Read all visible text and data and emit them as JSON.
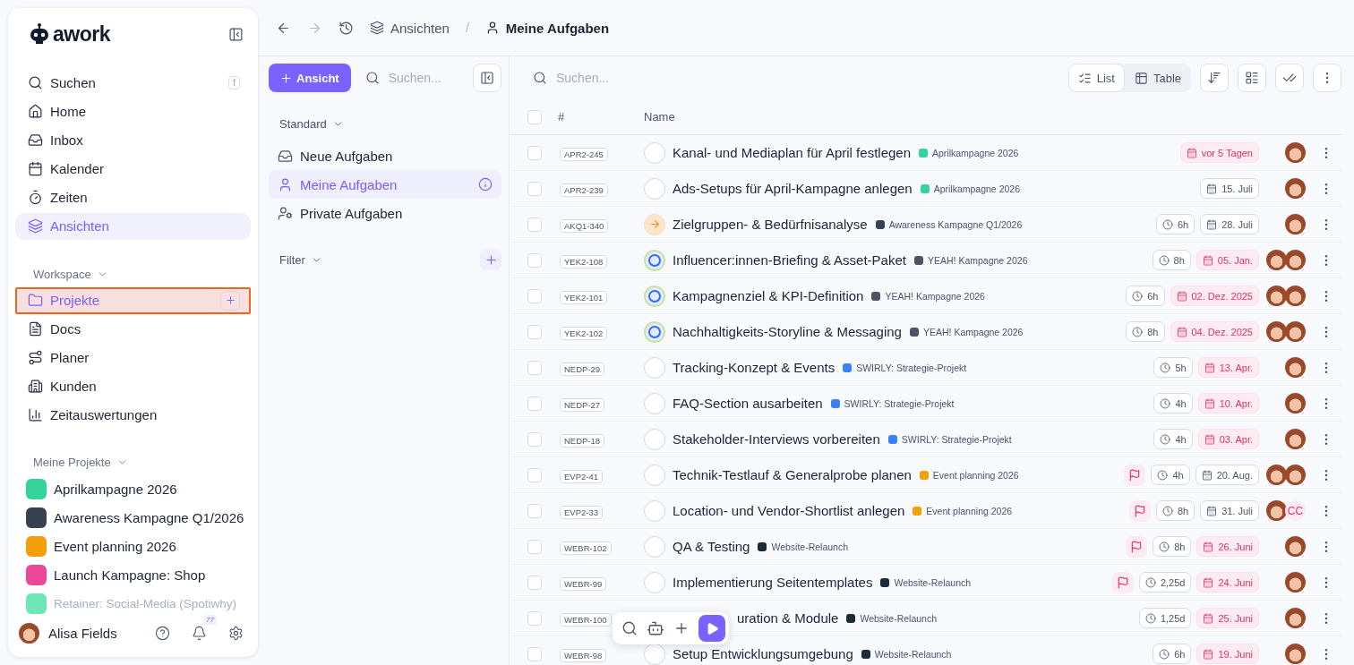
{
  "sidebar": {
    "logo": "awork",
    "search": {
      "label": "Suchen",
      "shortcut": "f"
    },
    "nav": [
      {
        "label": "Home",
        "selected": false
      },
      {
        "label": "Inbox",
        "selected": false
      },
      {
        "label": "Kalender",
        "selected": false
      },
      {
        "label": "Zeiten",
        "selected": false
      },
      {
        "label": "Ansichten",
        "selected": true
      }
    ],
    "workspace": {
      "title": "Workspace",
      "items": [
        {
          "label": "Projekte",
          "highlighted": true
        },
        {
          "label": "Docs",
          "highlighted": false
        },
        {
          "label": "Planer",
          "highlighted": false
        },
        {
          "label": "Kunden",
          "highlighted": false
        },
        {
          "label": "Zeitauswertungen",
          "highlighted": false
        }
      ]
    },
    "my_projects": {
      "title": "Meine Projekte",
      "items": [
        {
          "label": "Aprilkampagne 2026",
          "color": "#34d399",
          "faded": false
        },
        {
          "label": "Awareness Kampagne Q1/2026",
          "color": "#374151",
          "faded": false
        },
        {
          "label": "Event planning 2026",
          "color": "#f59e0b",
          "faded": false
        },
        {
          "label": "Launch Kampagne: Shop",
          "color": "#ec4899",
          "faded": false
        },
        {
          "label": "Retainer: Social-Media (Spotiwhy)",
          "color": "#6ee7b7",
          "faded": true
        }
      ]
    },
    "user": {
      "name": "Alisa Fields",
      "notifications": "77"
    }
  },
  "breadcrumb": {
    "separator": "/",
    "items": [
      "Ansichten",
      "Meine Aufgaben"
    ]
  },
  "views_panel": {
    "add_button": "Ansicht",
    "search_placeholder": "Suchen...",
    "group": "Standard",
    "views": [
      {
        "label": "Neue Aufgaben",
        "selected": false
      },
      {
        "label": "Meine Aufgaben",
        "selected": true
      },
      {
        "label": "Private Aufgaben",
        "selected": false
      }
    ],
    "filter": "Filter"
  },
  "tasks": {
    "search_placeholder": "Suchen...",
    "all_checked": false,
    "modes": [
      {
        "label": "List",
        "selected": true
      },
      {
        "label": "Table",
        "selected": false
      }
    ],
    "columns": [
      "#",
      "Name"
    ],
    "rows": [
      {
        "checked": false,
        "id": "APR2-245",
        "name": "Kanal- und Mediaplan für April festlegen",
        "kind": "open",
        "project": "Aprilkampagne 2026",
        "color": "#34d399",
        "flag": false,
        "due": {
          "text": "vor 5 Tagen",
          "overdue": true
        },
        "assignees": [
          {
            "kind": "avatar"
          }
        ]
      },
      {
        "checked": false,
        "id": "APR2-239",
        "name": "Ads-Setups für April-Kampagne anlegen",
        "kind": "open",
        "project": "Aprilkampagne 2026",
        "color": "#34d399",
        "flag": false,
        "due": {
          "text": "15. Juli",
          "overdue": false
        },
        "assignees": [
          {
            "kind": "avatar"
          }
        ]
      },
      {
        "checked": false,
        "id": "AKQ1-340",
        "name": "Zielgruppen- & Bedürfnisanalyse",
        "kind": "next",
        "project": "Awareness Kampagne Q1/2026",
        "color": "#374151",
        "flag": false,
        "effort": "6h",
        "due": {
          "text": "28. Juli",
          "overdue": false
        },
        "assignees": [
          {
            "kind": "avatar"
          }
        ]
      },
      {
        "checked": false,
        "id": "YEK2-108",
        "name": "Influencer:innen-Briefing & Asset-Paket",
        "kind": "progress",
        "project": "YEAH! Kampagne 2026",
        "color": "#4b5563",
        "flag": false,
        "effort": "8h",
        "due": {
          "text": "05. Jan.",
          "overdue": true
        },
        "assignees": [
          {
            "kind": "avatar"
          },
          {
            "kind": "avatar"
          }
        ]
      },
      {
        "checked": false,
        "id": "YEK2-101",
        "name": "Kampagnenziel & KPI-Definition",
        "kind": "progress",
        "project": "YEAH! Kampagne 2026",
        "color": "#4b5563",
        "flag": false,
        "effort": "6h",
        "due": {
          "text": "02. Dez. 2025",
          "overdue": true
        },
        "assignees": [
          {
            "kind": "avatar"
          },
          {
            "kind": "avatar"
          }
        ]
      },
      {
        "checked": false,
        "id": "YEK2-102",
        "name": "Nachhaltigkeits-Storyline & Messaging",
        "kind": "progress",
        "project": "YEAH! Kampagne 2026",
        "color": "#4b5563",
        "flag": false,
        "effort": "8h",
        "due": {
          "text": "04. Dez. 2025",
          "overdue": true
        },
        "assignees": [
          {
            "kind": "avatar"
          },
          {
            "kind": "avatar"
          }
        ]
      },
      {
        "checked": false,
        "id": "NEDP-29",
        "name": "Tracking-Konzept & Events",
        "kind": "open",
        "project": "SWIRLY: Strategie-Projekt",
        "color": "#3b82f6",
        "flag": false,
        "effort": "5h",
        "due": {
          "text": "13. Apr.",
          "overdue": true
        },
        "assignees": [
          {
            "kind": "avatar"
          }
        ]
      },
      {
        "checked": false,
        "id": "NEDP-27",
        "name": "FAQ-Section ausarbeiten",
        "kind": "open",
        "project": "SWIRLY: Strategie-Projekt",
        "color": "#3b82f6",
        "flag": false,
        "effort": "4h",
        "due": {
          "text": "10. Apr.",
          "overdue": true
        },
        "assignees": [
          {
            "kind": "avatar"
          }
        ]
      },
      {
        "checked": false,
        "id": "NEDP-18",
        "name": "Stakeholder-Interviews vorbereiten",
        "kind": "open",
        "project": "SWIRLY: Strategie-Projekt",
        "color": "#3b82f6",
        "flag": false,
        "effort": "4h",
        "due": {
          "text": "03. Apr.",
          "overdue": true
        },
        "assignees": [
          {
            "kind": "avatar"
          }
        ]
      },
      {
        "checked": false,
        "id": "EVP2-41",
        "name": "Technik-Testlauf & Generalprobe planen",
        "kind": "open",
        "project": "Event planning 2026",
        "color": "#f59e0b",
        "flag": true,
        "effort": "4h",
        "due": {
          "text": "20. Aug.",
          "overdue": false
        },
        "assignees": [
          {
            "kind": "avatar"
          },
          {
            "kind": "avatar"
          }
        ]
      },
      {
        "checked": false,
        "id": "EVP2-33",
        "name": "Location- und Vendor-Shortlist anlegen",
        "kind": "open",
        "project": "Event planning 2026",
        "color": "#f59e0b",
        "flag": true,
        "effort": "8h",
        "due": {
          "text": "31. Juli",
          "overdue": false
        },
        "assignees": [
          {
            "kind": "avatar"
          },
          {
            "kind": "initials",
            "text": "CC"
          }
        ]
      },
      {
        "checked": false,
        "id": "WEBR-102",
        "name": "QA & Testing",
        "kind": "open",
        "project": "Website-Relaunch",
        "color": "#1f2937",
        "flag": true,
        "effort": "8h",
        "due": {
          "text": "26. Juni",
          "overdue": true
        },
        "assignees": [
          {
            "kind": "avatar"
          }
        ]
      },
      {
        "checked": false,
        "id": "WEBR-99",
        "name": "Implementierung Seitentemplates",
        "kind": "open",
        "project": "Website-Relaunch",
        "color": "#1f2937",
        "flag": true,
        "effort": "2,25d",
        "due": {
          "text": "24. Juni",
          "overdue": true
        },
        "assignees": [
          {
            "kind": "avatar"
          }
        ]
      },
      {
        "checked": false,
        "id": "WEBR-100",
        "name": "uration & Module",
        "kind": "covered",
        "project": "Website-Relaunch",
        "color": "#1f2937",
        "flag": false,
        "effort": "1,25d",
        "due": {
          "text": "25. Juni",
          "overdue": true
        },
        "assignees": [
          {
            "kind": "avatar"
          }
        ]
      },
      {
        "checked": false,
        "id": "WEBR-98",
        "name": "Setup Entwicklungsumgebung",
        "kind": "open",
        "project": "Website-Relaunch",
        "color": "#1f2937",
        "flag": false,
        "effort": "6h",
        "due": {
          "text": "19. Juni",
          "overdue": true
        },
        "assignees": [
          {
            "kind": "avatar"
          }
        ]
      }
    ]
  }
}
